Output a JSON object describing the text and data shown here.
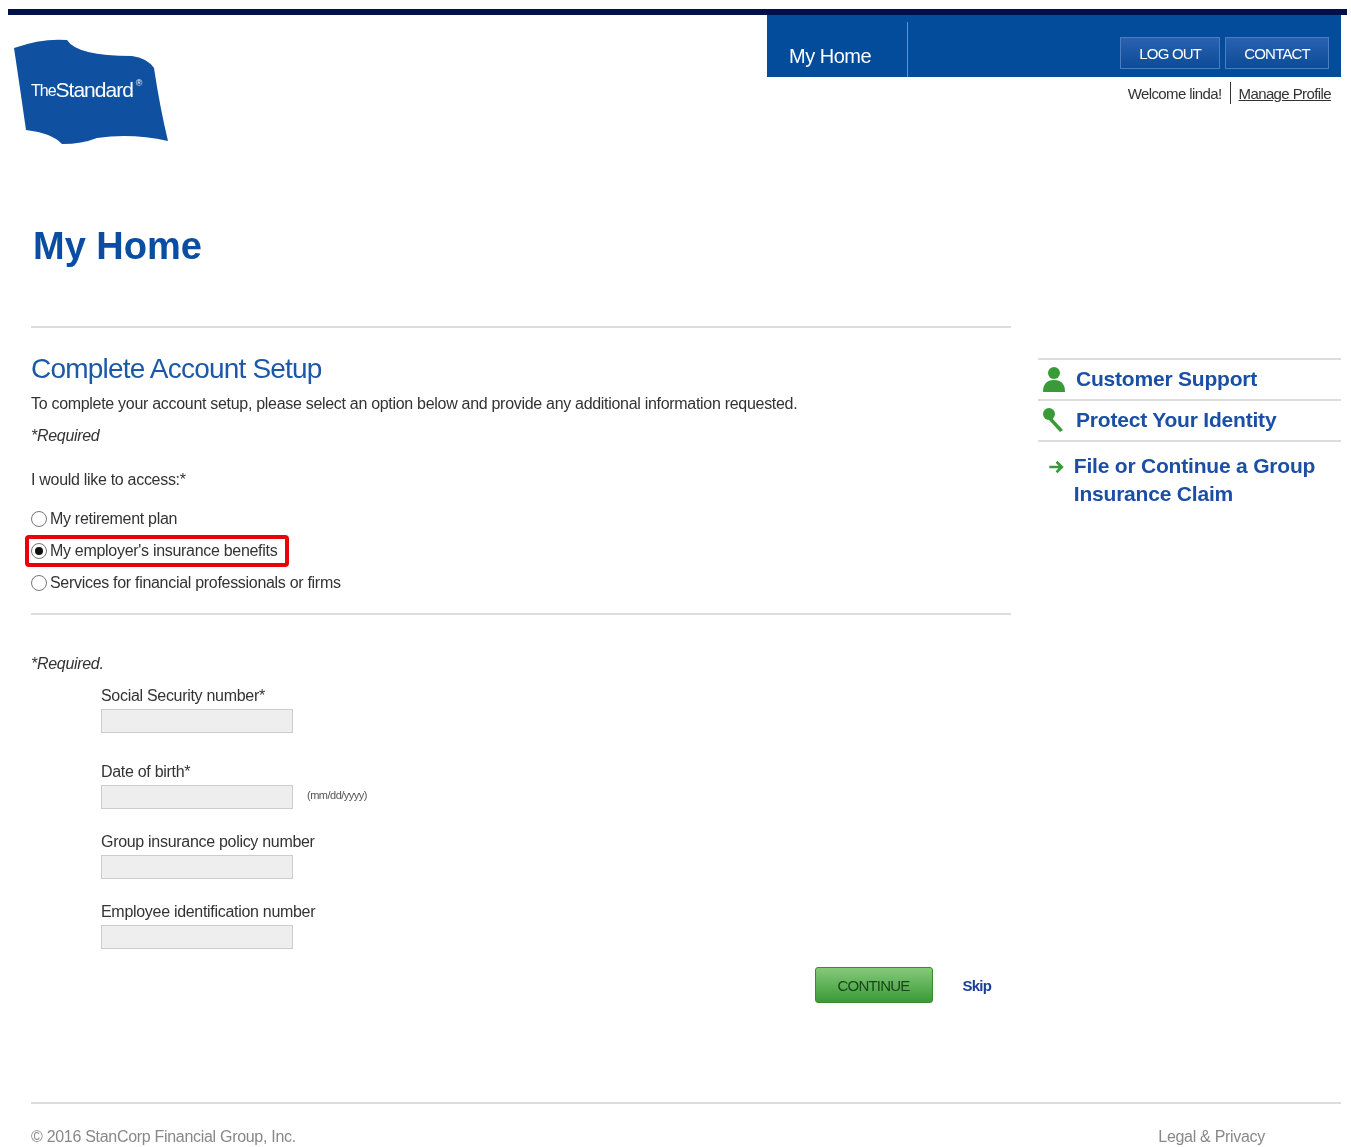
{
  "header": {
    "logo": {
      "word_1": "The",
      "word_2": "Standard",
      "mark": "®"
    },
    "nav_tab": "My Home",
    "buttons": [
      "LOG OUT",
      "CONTACT"
    ],
    "welcome": "Welcome linda!",
    "profile_link": "Manage Profile"
  },
  "page_title": "My Home",
  "setup": {
    "title": "Complete Account Setup",
    "intro": "To complete your account setup, please select an option below and provide any additional information requested.",
    "required_note": "*Required",
    "question": "I would like to access:*",
    "options": [
      {
        "label": "My retirement plan",
        "selected": false
      },
      {
        "label": "My employer's insurance benefits",
        "selected": true
      },
      {
        "label": "Services for financial professionals or firms",
        "selected": false
      }
    ]
  },
  "form": {
    "required_note": "*Required.",
    "fields": [
      {
        "label": "Social Security number*"
      },
      {
        "label": "Date of birth*",
        "hint": "(mm/dd/yyyy)"
      },
      {
        "label": "Group insurance policy number"
      },
      {
        "label": "Employee identification number"
      }
    ],
    "continue": "CONTINUE",
    "skip": "Skip"
  },
  "sidebar": {
    "links": [
      {
        "kind": "person",
        "label": "Customer Support"
      },
      {
        "kind": "key",
        "label": "Protect Your Identity"
      },
      {
        "kind": "arrow",
        "label": "File or Continue a Group Insurance Claim"
      }
    ]
  },
  "footer": {
    "copyright": "© 2016 StanCorp Financial Group, Inc.",
    "legal": "Legal & Privacy"
  }
}
